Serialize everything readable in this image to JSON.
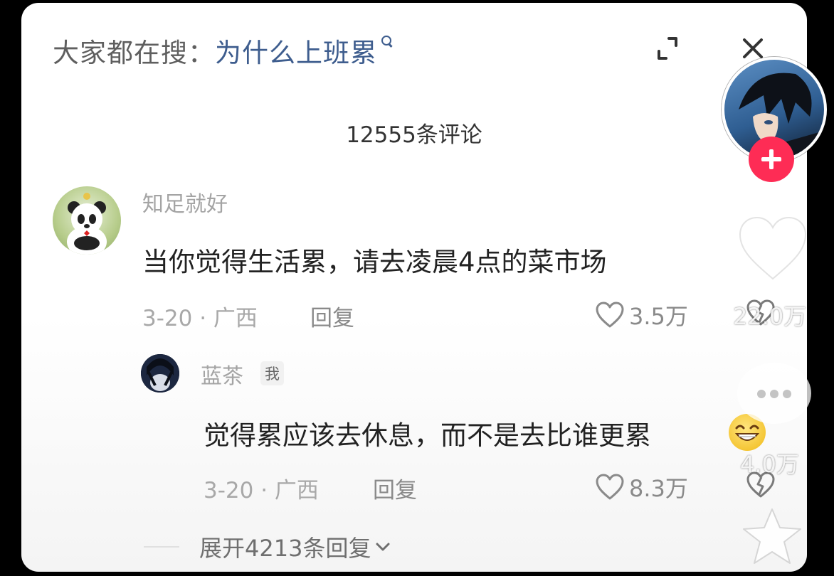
{
  "search": {
    "prefix": "大家都在搜：",
    "query": "为什么上班累"
  },
  "header": {
    "comment_count": "12555条评论"
  },
  "comments": [
    {
      "username": "知足就好",
      "text": "当你觉得生活累，请去凌晨4点的菜市场",
      "date_location": "3-20 · 广西",
      "reply_label": "回复",
      "likes": "3.5万"
    }
  ],
  "reply": {
    "username": "蓝茶",
    "badge": "我",
    "text": "觉得累应该去休息，而不是去比谁更累",
    "date_location": "3-20 · 广西",
    "reply_label": "回复",
    "likes": "8.3万"
  },
  "expand_replies": {
    "label": "展开4213条回复"
  },
  "sidebar": {
    "like_count": "22.0万",
    "comment_count": "4.0万"
  },
  "colors": {
    "accent_follow": "#fe2c55",
    "search_query": "#3e5d8e",
    "meta_gray": "#a8a8a8"
  },
  "icons": [
    "search-icon",
    "expand-icon",
    "close-icon",
    "heart-icon",
    "dislike-icon",
    "chevron-down-icon",
    "plus-icon",
    "laugh-emoji-icon"
  ]
}
